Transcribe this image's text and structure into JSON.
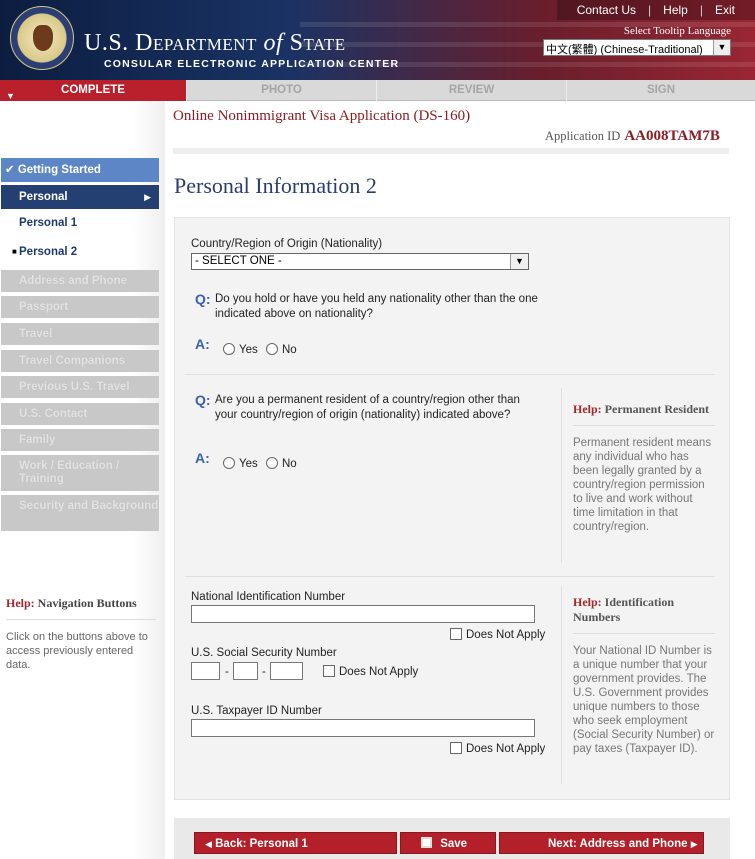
{
  "header": {
    "links": [
      "Contact Us",
      "Help",
      "Exit"
    ],
    "title_prefix": "U.S. D",
    "title_dept_rest": "EPARTMENT",
    "title_of": "of",
    "title_state_initial": "S",
    "title_state_rest": "TATE",
    "subtitle": "CONSULAR ELECTRONIC APPLICATION CENTER",
    "tooltip_label": "Select Tooltip Language",
    "language_selected": "中文(繁體)  (Chinese-Traditional)"
  },
  "steps": {
    "complete": "COMPLETE",
    "photo": "PHOTO",
    "review": "REVIEW",
    "sign": "SIGN"
  },
  "app": {
    "title": "Online Nonimmigrant Visa Application (DS-160)",
    "id_label": "Application ID",
    "id_value": "AA008TAM7B",
    "page_title": "Personal Information 2"
  },
  "sidebar": {
    "getting_started": "Getting Started",
    "personal": "Personal",
    "personal_1": "Personal 1",
    "personal_2": "Personal 2",
    "disabled_items": [
      "Address and Phone",
      "Passport",
      "Travel",
      "Travel Companions",
      "Previous U.S. Travel",
      "U.S. Contact",
      "Family",
      "Work / Education / Training",
      "Security and Background"
    ],
    "help_title_prefix": "Help:",
    "help_title": "Navigation Buttons",
    "help_body": "Click on the buttons above to access previously entered data."
  },
  "form": {
    "nationality_label": "Country/Region of Origin (Nationality)",
    "nationality_value": "- SELECT ONE -",
    "q_marker": "Q:",
    "a_marker": "A:",
    "q1": "Do you hold or have you held any nationality other than the one indicated above on nationality?",
    "q2": "Are you a permanent resident of a country/region other than your country/region of origin (nationality) indicated above?",
    "yes": "Yes",
    "no": "No",
    "help_pr_prefix": "Help:",
    "help_pr_title": "Permanent Resident",
    "help_pr_body": "Permanent resident means any individual who has been legally granted by a country/region permission to live and work without time limitation in that country/region.",
    "nid_label": "National Identification Number",
    "ssn_label": "U.S. Social Security Number",
    "taxpayer_label": "U.S. Taxpayer ID Number",
    "does_not_apply": "Does Not Apply",
    "ssn_sep": "-",
    "help_id_prefix": "Help:",
    "help_id_title": "Identification Numbers",
    "help_id_body": "Your National ID Number is a unique number that your government provides. The U.S. Government provides unique numbers to those who seek employment (Social Security Number) or pay taxes (Taxpayer ID)."
  },
  "footer_nav": {
    "back": "Back: Personal 1",
    "save": "Save",
    "next": "Next: Address and Phone"
  },
  "colors": {
    "accent_red": "#b3202a",
    "nav_blue": "#243f72",
    "nav_light_blue": "#5c86c6"
  }
}
